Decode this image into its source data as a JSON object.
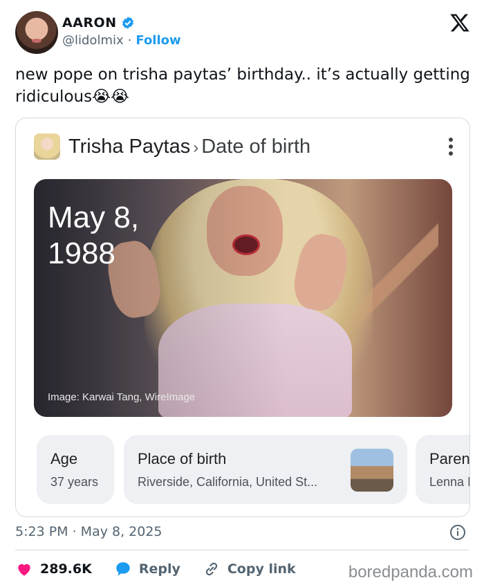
{
  "author": {
    "name": "AARON",
    "handle": "@lidolmix",
    "separator": "·",
    "follow_label": "Follow"
  },
  "tweet": {
    "text": "new pope on trisha paytas’ birthday.. it’s actually getting ridiculous😭😭"
  },
  "card": {
    "entity": "Trisha Paytas",
    "breadcrumb_separator": "›",
    "attribute": "Date of birth",
    "date_line1": "May 8,",
    "date_line2": "1988",
    "image_credit": "Image: Karwai Tang, WireImage",
    "facts": [
      {
        "label": "Age",
        "value": "37 years"
      },
      {
        "label": "Place of birth",
        "value": "Riverside, California, United St..."
      },
      {
        "label": "Paren",
        "value": "Lenna I"
      }
    ]
  },
  "meta": {
    "timestamp": "5:23 PM · May 8, 2025"
  },
  "actions": {
    "likes": "289.6K",
    "reply_label": "Reply",
    "copy_link_label": "Copy link"
  },
  "watermark": "boredpanda.com",
  "colors": {
    "accent": "#1d9bf0",
    "like": "#f91880",
    "text_secondary": "#536471"
  }
}
